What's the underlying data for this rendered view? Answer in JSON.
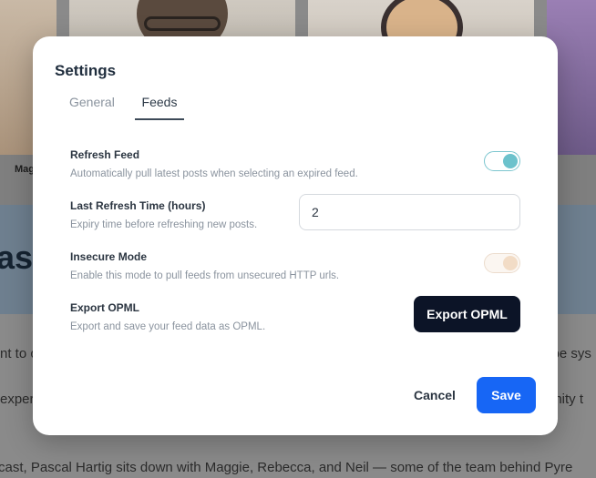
{
  "background": {
    "participant_name": "Mag",
    "banner_title": "ast",
    "body_lines": [
      "nt to c",
      "ype sys",
      "exper",
      "unity t",
      "cast, Pascal Hartig sits down with Maggie, Rebecca, and Neil — some of the team behind Pyre"
    ]
  },
  "settings": {
    "title": "Settings",
    "tabs": [
      {
        "label": "General",
        "active": false
      },
      {
        "label": "Feeds",
        "active": true
      }
    ],
    "refresh_feed": {
      "label": "Refresh Feed",
      "description": "Automatically pull latest posts when selecting an expired feed.",
      "enabled": true
    },
    "last_refresh_time": {
      "label": "Last Refresh Time (hours)",
      "description": "Expiry time before refreshing new posts.",
      "value": "2"
    },
    "insecure_mode": {
      "label": "Insecure Mode",
      "description": "Enable this mode to pull feeds from unsecured HTTP urls.",
      "enabled": true
    },
    "export_opml": {
      "label": "Export OPML",
      "description": "Export and save your feed data as OPML.",
      "button_label": "Export OPML"
    },
    "actions": {
      "cancel_label": "Cancel",
      "save_label": "Save"
    }
  },
  "colors": {
    "primary": "#1766f5",
    "dark_button": "#0c1427",
    "toggle_on": "#6cc2cc",
    "toggle_insecure": "#f2dcc6"
  }
}
